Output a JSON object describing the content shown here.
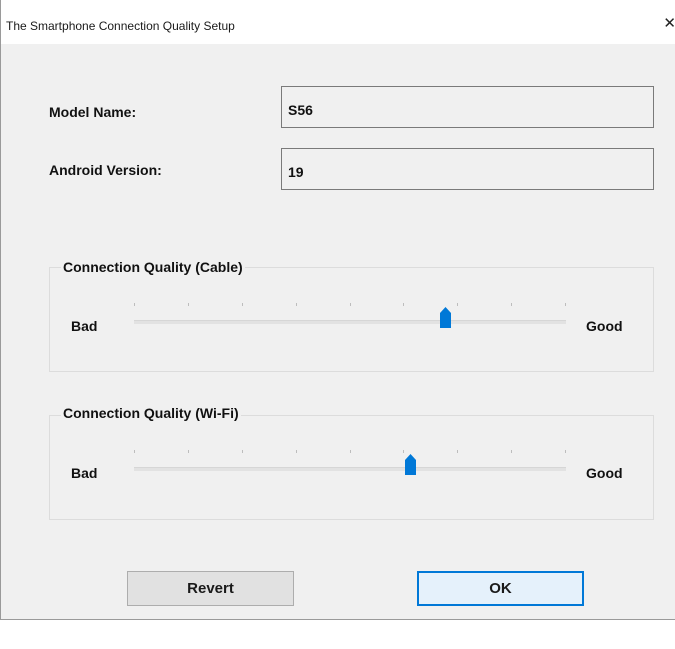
{
  "window": {
    "title": "The Smartphone Connection Quality Setup",
    "close_symbol": "✕"
  },
  "form": {
    "model_label": "Model Name:",
    "model_value": "S56",
    "android_label": "Android Version:",
    "android_value": "19"
  },
  "cable": {
    "title": "Connection Quality (Cable)",
    "min_label": "Bad",
    "max_label": "Good",
    "value_fraction": 0.72,
    "tick_count": 9
  },
  "wifi": {
    "title": "Connection Quality (Wi-Fi)",
    "min_label": "Bad",
    "max_label": "Good",
    "value_fraction": 0.64,
    "tick_count": 9
  },
  "buttons": {
    "revert_label": "Revert",
    "ok_label": "OK"
  },
  "colors": {
    "thumb": "#0078d7",
    "default_button_border": "#0078d7"
  }
}
